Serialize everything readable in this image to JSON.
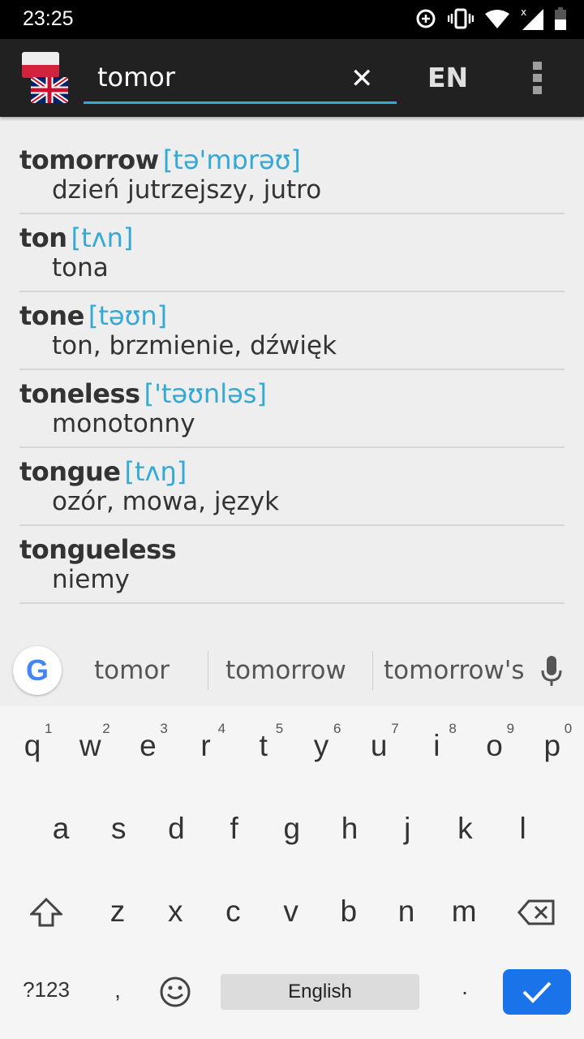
{
  "status": {
    "time": "23:25"
  },
  "toolbar": {
    "query": "tomor",
    "lang": "EN"
  },
  "results": [
    {
      "word": "tomorrow",
      "phon": "[tə'mɒrəʊ]",
      "trans": "dzień jutrzejszy, jutro"
    },
    {
      "word": "ton",
      "phon": "[tʌn]",
      "trans": "tona"
    },
    {
      "word": "tone",
      "phon": "[təʊn]",
      "trans": "ton, brzmienie, dźwięk"
    },
    {
      "word": "toneless",
      "phon": "['təʊnləs]",
      "trans": "monotonny"
    },
    {
      "word": "tongue",
      "phon": "[tʌŋ]",
      "trans": "ozór, mowa, język"
    },
    {
      "word": "tongueless",
      "phon": "",
      "trans": "niemy"
    }
  ],
  "keyboard": {
    "suggestions": [
      "tomor",
      "tomorrow",
      "tomorrow's"
    ],
    "row1": [
      "q",
      "w",
      "e",
      "r",
      "t",
      "y",
      "u",
      "i",
      "o",
      "p"
    ],
    "hints": [
      "1",
      "2",
      "3",
      "4",
      "5",
      "6",
      "7",
      "8",
      "9",
      "0"
    ],
    "row2": [
      "a",
      "s",
      "d",
      "f",
      "g",
      "h",
      "j",
      "k",
      "l"
    ],
    "row3": [
      "z",
      "x",
      "c",
      "v",
      "b",
      "n",
      "m"
    ],
    "symbols": "?123",
    "comma": ",",
    "space": "English",
    "period": "."
  },
  "colors": {
    "accent": "#33a9d4",
    "enter": "#1a73e8"
  }
}
